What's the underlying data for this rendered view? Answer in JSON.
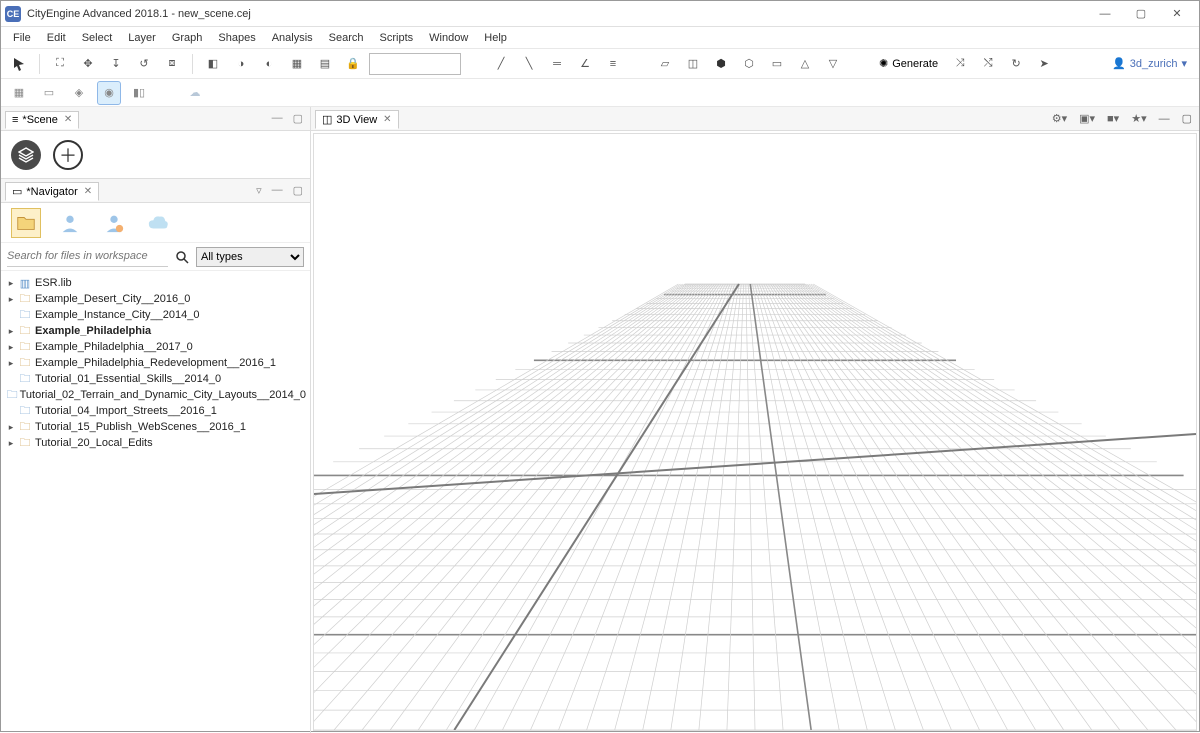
{
  "title": "CityEngine Advanced 2018.1 - new_scene.cej",
  "menus": [
    "File",
    "Edit",
    "Select",
    "Layer",
    "Graph",
    "Shapes",
    "Analysis",
    "Search",
    "Scripts",
    "Window",
    "Help"
  ],
  "toolbar1": {
    "generate_label": "Generate",
    "search_value": ""
  },
  "user": "3d_zurich",
  "scene_tab": "*Scene",
  "navigator_tab": "*Navigator",
  "view_tab": "3D View",
  "search": {
    "placeholder": "Search for files in workspace",
    "filter": "All types"
  },
  "tree": [
    {
      "expandable": true,
      "icon": "lib",
      "label": "ESR.lib",
      "bold": false
    },
    {
      "expandable": true,
      "icon": "proj",
      "label": "Example_Desert_City__2016_0",
      "bold": false
    },
    {
      "expandable": false,
      "icon": "folder",
      "label": "Example_Instance_City__2014_0",
      "bold": false
    },
    {
      "expandable": true,
      "icon": "proj",
      "label": "Example_Philadelphia",
      "bold": true
    },
    {
      "expandable": true,
      "icon": "proj",
      "label": "Example_Philadelphia__2017_0",
      "bold": false
    },
    {
      "expandable": true,
      "icon": "proj",
      "label": "Example_Philadelphia_Redevelopment__2016_1",
      "bold": false
    },
    {
      "expandable": false,
      "icon": "folder",
      "label": "Tutorial_01_Essential_Skills__2014_0",
      "bold": false
    },
    {
      "expandable": false,
      "icon": "folder",
      "label": "Tutorial_02_Terrain_and_Dynamic_City_Layouts__2014_0",
      "bold": false
    },
    {
      "expandable": false,
      "icon": "folder",
      "label": "Tutorial_04_Import_Streets__2016_1",
      "bold": false
    },
    {
      "expandable": true,
      "icon": "proj",
      "label": "Tutorial_15_Publish_WebScenes__2016_1",
      "bold": false
    },
    {
      "expandable": true,
      "icon": "proj",
      "label": "Tutorial_20_Local_Edits",
      "bold": false
    }
  ]
}
